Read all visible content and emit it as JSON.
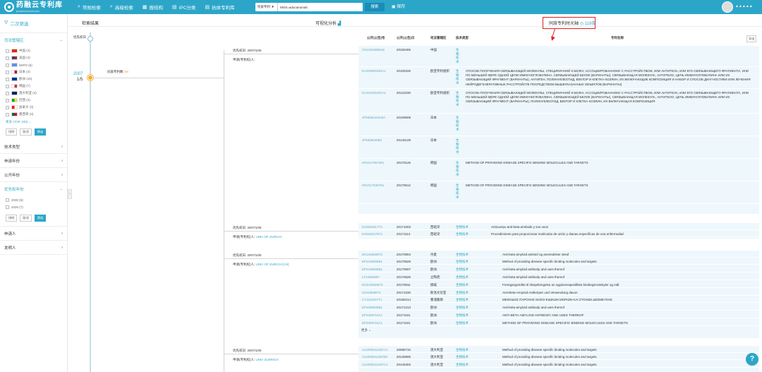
{
  "app": {
    "logo_text": "药融云专利库",
    "logo_sub": "pharnexcloud.com"
  },
  "nav": [
    {
      "icon": "⌕",
      "label": "常规检索"
    },
    {
      "icon": "⌕",
      "label": "高级检索"
    },
    {
      "icon": "▦",
      "label": "搜结构"
    },
    {
      "icon": "▤",
      "label": "IPC分类"
    },
    {
      "icon": "▤",
      "label": "抗体专利库"
    }
  ],
  "search": {
    "type": "检索专利 ▼",
    "value": "MOS=aducanumab",
    "button": "搜索"
  },
  "save_label": "保存",
  "user": {
    "name": "▲▲▲▲▲"
  },
  "sidebar": {
    "title": "二次筛选",
    "jurisdiction_title": "司法管辖区",
    "countries": [
      {
        "label": "中国 (4)",
        "c1": "#de2910",
        "c2": "#de2910"
      },
      {
        "label": "美国 (4)",
        "c1": "#3c3b6e",
        "c2": "#b22234"
      },
      {
        "label": "WIPO (6)",
        "c1": "#5b92e5",
        "c2": "#5b92e5"
      },
      {
        "label": "日本 (4)",
        "c1": "#ffffff",
        "c2": "#bc002d"
      },
      {
        "label": "欧洲 (16)",
        "c1": "#003399",
        "c2": "#003399"
      },
      {
        "label": "韩国 (7)",
        "c1": "#ffffff",
        "c2": "#cd2e3a"
      },
      {
        "label": "澳大利亚 (4)",
        "c1": "#012169",
        "c2": "#012169"
      },
      {
        "label": "巴西 (4)",
        "c1": "#009c3b",
        "c2": "#ffdf00"
      },
      {
        "label": "加拿大 (3)",
        "c1": "#ff0000",
        "c2": "#ffffff"
      },
      {
        "label": "墨西哥 (3)",
        "c1": "#006847",
        "c2": "#ce1126"
      }
    ],
    "more": "更多 (TOP 100) ⌄",
    "btn_exclude": "排除",
    "btn_cancel": "取消",
    "btn_filter": "筛选",
    "sections": [
      "技术类型",
      "申请年份",
      "公开年份"
    ],
    "priority_title": "优先权年份",
    "priority_items": [
      "2030 (6)",
      "2026 (7)"
    ],
    "sections2": [
      "申请人",
      "发明人"
    ]
  },
  "tabs": {
    "search_result": "检索结果",
    "visual": "可视化分析",
    "timeline": "同族专利时光轴",
    "timeline_count": "119条"
  },
  "timeline": {
    "label": "优先权日",
    "year": "2007",
    "fraction": "1/5",
    "family_label": "同族专利数",
    "family_count": "56"
  },
  "table_headers": {
    "pub_no": "公开(公告)号",
    "pub_date": "公开(公告)日",
    "jurisdiction": "司法管辖区",
    "tech": "技术类型",
    "title": "专利名称",
    "export": "导出"
  },
  "families": [
    {
      "priority": "优先权日: 2007/10/5",
      "applicant_label": "申请(专利权)人: ",
      "applicant": "",
      "rows": [
        {
          "pn": "CN101849851B",
          "date": "20150406",
          "jur": "中国",
          "tech": "生物技术",
          "title": ""
        },
        {
          "pn": "EA200900494A1",
          "date": "20100226",
          "jur": "欧亚专利组织",
          "tech": "生物技术",
          "title": "СПОСОБ ПОЛУЧЕНИЯ СВЯЗЫВАЮЩЕЙ МОЛЕКУЛЫ, СПЕЦИФИЧНОЙ К БЕЛКУ, АССОЦИИРОВАННОМУ С РАССТРОЙСТВОМ, ИЛИ АНТИТЕЛА, ИЛИ ЕГО СВЯЗЫВАЮЩЕГО ФРАГМЕНТА, ИЛИ ПО МЕНЬШЕЙ МЕРЕ ОДНОЙ ЦЕПИ ИММУНОГЛОБУЛИНА, СВЯЗЫВАЮЩЕЙ БЕЛОК (ВАРИАНТЫ), СВЯЗЫВАЮЩАЯ МОЛЕКУЛА, АНТИТЕЛО, ЦЕПЬ ИММУНОГЛОБУЛИНА ИЛИ ИХ СВЯЗЫВАЮЩИЙ ФРАГМЕНТ (ВАРИАНТЫ), АНТИГЕН, ПОЛИНУКЛЕОТИД, ВЕКТОР И КЛЕТКА-ХОЗЯИН, ИХ ВКЛЮЧАЮЩИЕ КОМПОЗИЦИЯ И НАБОР И СПОСОБ ДИАГНОСТИКИ ИЛИ ЛЕЧЕНИЯ НЕЙРОДЕГЕНЕРАТИВНЫХ РАССТРОЙСТВ ПОСРЕДСТВОМ ВЫШЕУКАЗАННЫХ ОБЪЕКТОВ (ВАРИАНТЫ)"
        },
        {
          "pn": "EA201201001A1",
          "date": "20131030",
          "jur": "欧亚专利组织",
          "tech": "生物技术",
          "title": "СПОСОБ ПОЛУЧЕНИЯ СВЯЗЫВАЮЩЕЙ МОЛЕКУЛЫ, СПЕЦИФИЧНОЙ К БЕЛКУ, АССОЦИИРОВАННОМУ С РАССТРОЙСТВОМ, ИЛИ АНТИТЕЛА, ИЛИ ЕГО СВЯЗЫВАЮЩЕГО ФРАГМЕНТА, ИЛИ ПО МЕНЬШЕЙ МЕРЕ ОДНОЙ ЦЕПИ ИММУНОГЛОБУЛИНА, СВЯЗЫВАЮЩЕЙ БЕЛОК (ВАРИАНТЫ), СВЯЗЫВАЮЩАЯ МОЛЕКУЛА, АНТИТЕЛО, ЦЕПЬ ИММУНОГЛОБУЛИНА ИЛИ ИХ СВЯЗЫВАЮЩИЙ ФРАГМЕНТ (ВАРИАНТЫ), ПОЛИНУКЛЕОТИД, ВЕКТОР И КЛЕТКА-ХОЗЯИН, ИХ ВКЛЮЧАЮЩАЯ КОМПОЗИЦИЯ"
        },
        {
          "pn": "JP5508410448A",
          "date": "20100508",
          "jur": "日本",
          "tech": "生物技术",
          "title": ""
        },
        {
          "pn": "JP5508549B2",
          "date": "20140129",
          "jur": "日本",
          "tech": "生物技术",
          "title": ""
        },
        {
          "pn": "KR1017057381",
          "date": "20170126",
          "jur": "韩国",
          "tech": "生物技术",
          "title": "METHOD OF PROVIDING DISEASE SPECIFIC BINDING MOLECULES AND TARGETS"
        },
        {
          "pn": "KR1017530781",
          "date": "20170612",
          "jur": "韩国",
          "tech": "生物技术",
          "title": "METHOD OF PROVIDING DISEASE SPECIFIC BINDING MOLECULES AND TARGETS"
        }
      ]
    },
    {
      "priority": "优先权日: 2007/10/5",
      "applicant_label": "申请(专利权)人: ",
      "applicant": "UNIV OF ZURICH",
      "rows": [
        {
          "pn": "ES2650317T3",
          "date": "20171003",
          "jur": "西班牙",
          "tech": "生物技术",
          "title": "Anticuerpo anti-beta-amiloide y sus usos"
        },
        {
          "pn": "ES2640179T3",
          "date": "20171114",
          "jur": "西班牙",
          "tech": "生物技术",
          "title": "Procedimiento para proporcionar moléculas de unión y dianas específicas de una enfermedad"
        }
      ]
    },
    {
      "priority": "优先权日: 2007/10/5",
      "applicant_label": "申请(专利权)人: ",
      "applicant": "UNIV OF ZURICH [CH]",
      "rows": [
        {
          "pn": "DK2436696T3",
          "date": "20170904",
          "jur": "丹麦",
          "tech": "生物技术",
          "title": "Anti-beta-amyloid antistof og anvendelser deraf"
        },
        {
          "pn": "EP2436696B1",
          "date": "20170628",
          "jur": "欧洲",
          "tech": "生物技术",
          "title": "Method of providing disease specific binding molecules and targets"
        },
        {
          "pn": "EP2436696B1",
          "date": "20170607",
          "jur": "欧洲",
          "tech": "生物技术",
          "title": "Anti-beta-amyloid antibody and uses thereof"
        },
        {
          "pn": "LT2436696T",
          "date": "20170626",
          "jur": "立陶宛",
          "tech": "生物技术",
          "title": "Anti-beta-amyloid antibody and uses thereof"
        },
        {
          "pn": "NO2436696T3",
          "date": "20170811",
          "jur": "挪威",
          "tech": "生物技术",
          "title": "Fremgangsmåte til tilvejebringelse av sygdomsspesifikke bindingsmolekyler og mål"
        },
        {
          "pn": "SI2436696T1",
          "date": "20171030",
          "jur": "斯洛文尼亚",
          "tech": "生物技术",
          "title": "Anti-Beta-Amyloid-Antikörper und Verwendung davon"
        },
        {
          "pn": "CY1119167T1",
          "date": "20180214",
          "jur": "塞浦路斯",
          "tech": "生物技术",
          "title": "ΜΕΘΟΔΟΣ ΠΑΡΟΧΗΣ ΝΟΣΟ-ΕΙΔΙΚΩΝ ΜΟΡΙΩΝ ΚΑΙ ΣΤΟΧΩΝ ΔΕΣΜΕΥΣΗΣ"
        },
        {
          "pn": "EP3309905B1",
          "date": "20171213",
          "jur": "欧洲",
          "tech": "生物技术",
          "title": "Anti-beta-amyloid antibody and uses thereof"
        },
        {
          "pn": "EP3309710A1",
          "date": "20171101",
          "jur": "欧洲",
          "tech": "生物技术",
          "title": "ANTI-BETA-AMYLOID ANTIBODY AND USES THEREOF"
        },
        {
          "pn": "EP3309715A1",
          "date": "20171101",
          "jur": "欧洲",
          "tech": "生物技术",
          "title": "METHOD OF PROVIDING DISEASE SPECIFIC BINDING MOLECULES AND TARGETS"
        }
      ],
      "more": "更多 ⌄"
    },
    {
      "priority": "优先权日: 2007/10/5",
      "applicant_label": "申请(专利权)人: ",
      "applicant": "UNIV ZUERICH",
      "rows": [
        {
          "pn": "AU2008311367A1",
          "date": "20090710",
          "jur": "澳大利亚",
          "tech": "生物技术",
          "title": "Method of providing disease specific binding molecules and targets"
        },
        {
          "pn": "AU2008311367B2",
          "date": "20130905",
          "jur": "澳大利亚",
          "tech": "生物技术",
          "title": "Method of providing disease specific binding molecules and targets"
        },
        {
          "pn": "AU2008311367C1",
          "date": "20140403",
          "jur": "澳大利亚",
          "tech": "生物技术",
          "title": "Method of providing disease specific binding molecules and targets"
        }
      ]
    }
  ],
  "help": "?"
}
